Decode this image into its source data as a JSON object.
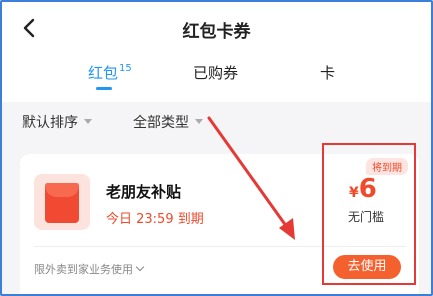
{
  "header": {
    "title": "红包卡券",
    "back_icon": "chevron-left-icon"
  },
  "tabs": [
    {
      "label": "红包",
      "badge": "15",
      "active": true
    },
    {
      "label": "已购券",
      "active": false
    },
    {
      "label": "卡",
      "active": false
    }
  ],
  "filters": {
    "sort_label": "默认排序",
    "type_label": "全部类型"
  },
  "coupon": {
    "title": "老朋友补贴",
    "expiry": "今日 23:59 到期",
    "tag": "将到期",
    "currency": "¥",
    "amount": "6",
    "threshold": "无门槛",
    "scope": "限外卖到家业务使用",
    "use_label": "去使用"
  },
  "colors": {
    "accent_blue": "#2196f3",
    "brand_red": "#f04a2a",
    "button_orange": "#f5602f",
    "annotation_red": "#e53935"
  }
}
